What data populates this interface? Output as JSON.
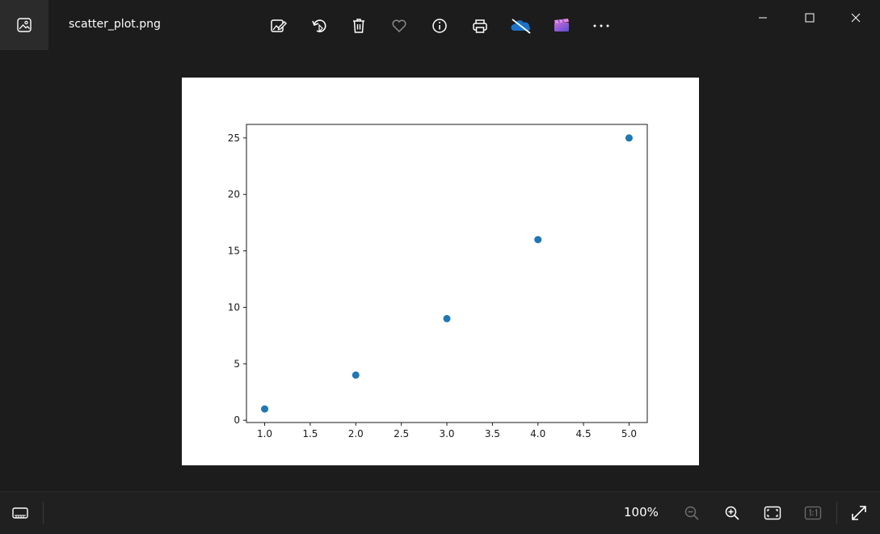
{
  "window": {
    "file_name": "scatter_plot.png",
    "controls": [
      "minimize",
      "maximize",
      "close"
    ]
  },
  "toolbar": {
    "buttons": [
      {
        "name": "edit-image-button",
        "icon": "edit-image-icon"
      },
      {
        "name": "rotate-button",
        "icon": "rotate-icon"
      },
      {
        "name": "delete-button",
        "icon": "trash-icon"
      },
      {
        "name": "favorite-button",
        "icon": "heart-icon"
      },
      {
        "name": "info-button",
        "icon": "info-icon"
      },
      {
        "name": "print-button",
        "icon": "print-icon"
      },
      {
        "name": "onedrive-button",
        "icon": "onedrive-off-icon"
      },
      {
        "name": "clipchamp-button",
        "icon": "clipchamp-icon"
      },
      {
        "name": "more-button",
        "icon": "more-icon"
      }
    ]
  },
  "bottom_bar": {
    "zoom_level": "100%",
    "buttons": [
      "filmstrip-icon",
      "zoom-out-icon",
      "zoom-in-icon",
      "fit-to-window-icon",
      "actual-size-icon",
      "fullscreen-icon"
    ]
  },
  "chart_data": {
    "type": "scatter",
    "x": [
      1.0,
      2.0,
      3.0,
      4.0,
      5.0
    ],
    "y": [
      1,
      4,
      9,
      16,
      25
    ],
    "xticks": [
      "1.0",
      "1.5",
      "2.0",
      "2.5",
      "3.0",
      "3.5",
      "4.0",
      "4.5",
      "5.0"
    ],
    "yticks": [
      "0",
      "5",
      "10",
      "15",
      "20",
      "25"
    ],
    "xlim": [
      0.8,
      5.2
    ],
    "ylim": [
      -0.2,
      26.2
    ],
    "marker_color": "#1f77b4",
    "title": "",
    "xlabel": "",
    "ylabel": "",
    "grid": false
  }
}
